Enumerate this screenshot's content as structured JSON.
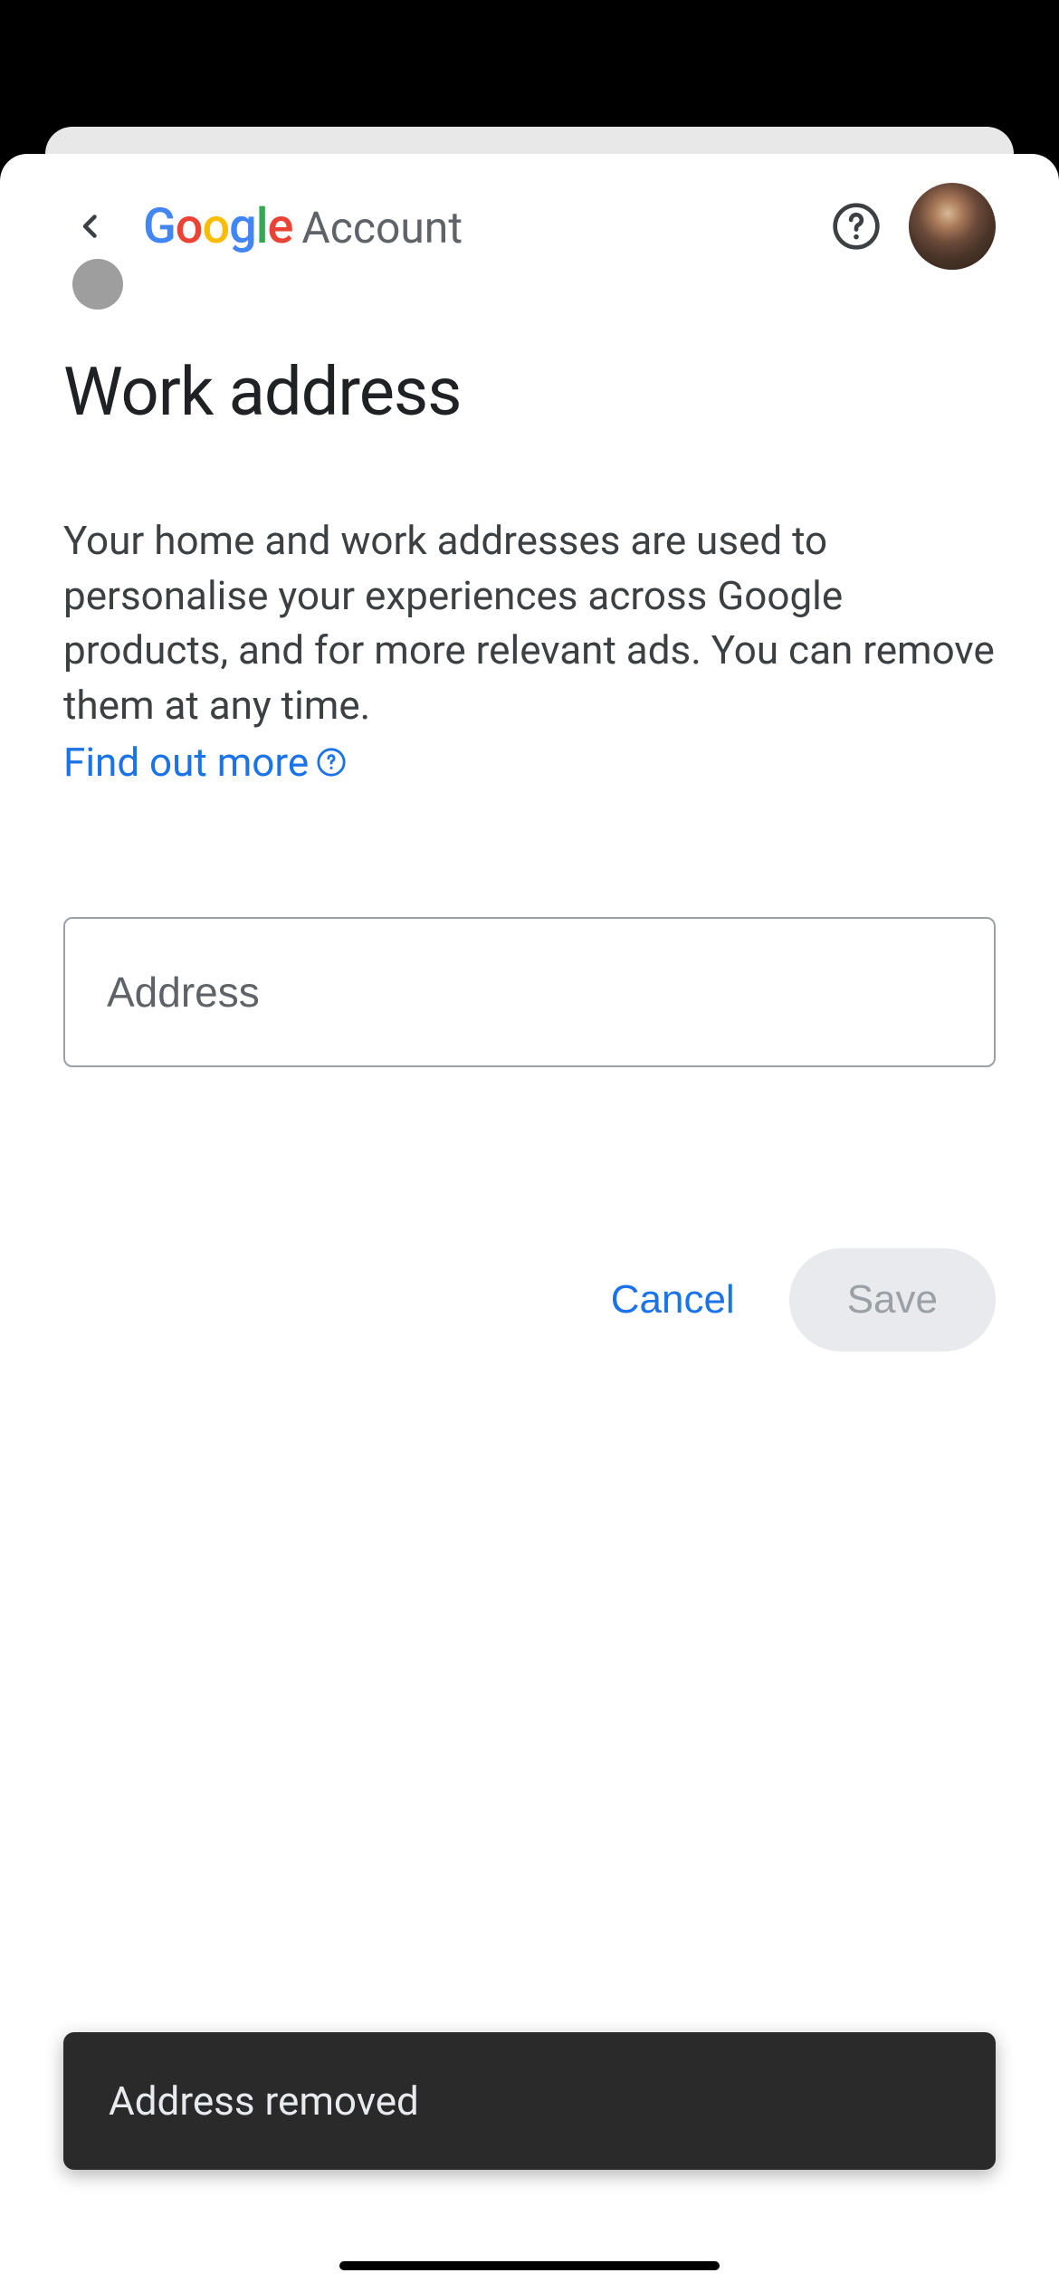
{
  "header": {
    "logo_google": "Google",
    "logo_account": "Account"
  },
  "page": {
    "title": "Work address",
    "description": "Your home and work addresses are used to personalise your experiences across Google products, and for more relevant ads. You can remove them at any time.",
    "learn_more": "Find out more"
  },
  "form": {
    "address_placeholder": "Address",
    "address_value": ""
  },
  "buttons": {
    "cancel": "Cancel",
    "save": "Save"
  },
  "toast": {
    "message": "Address removed"
  }
}
